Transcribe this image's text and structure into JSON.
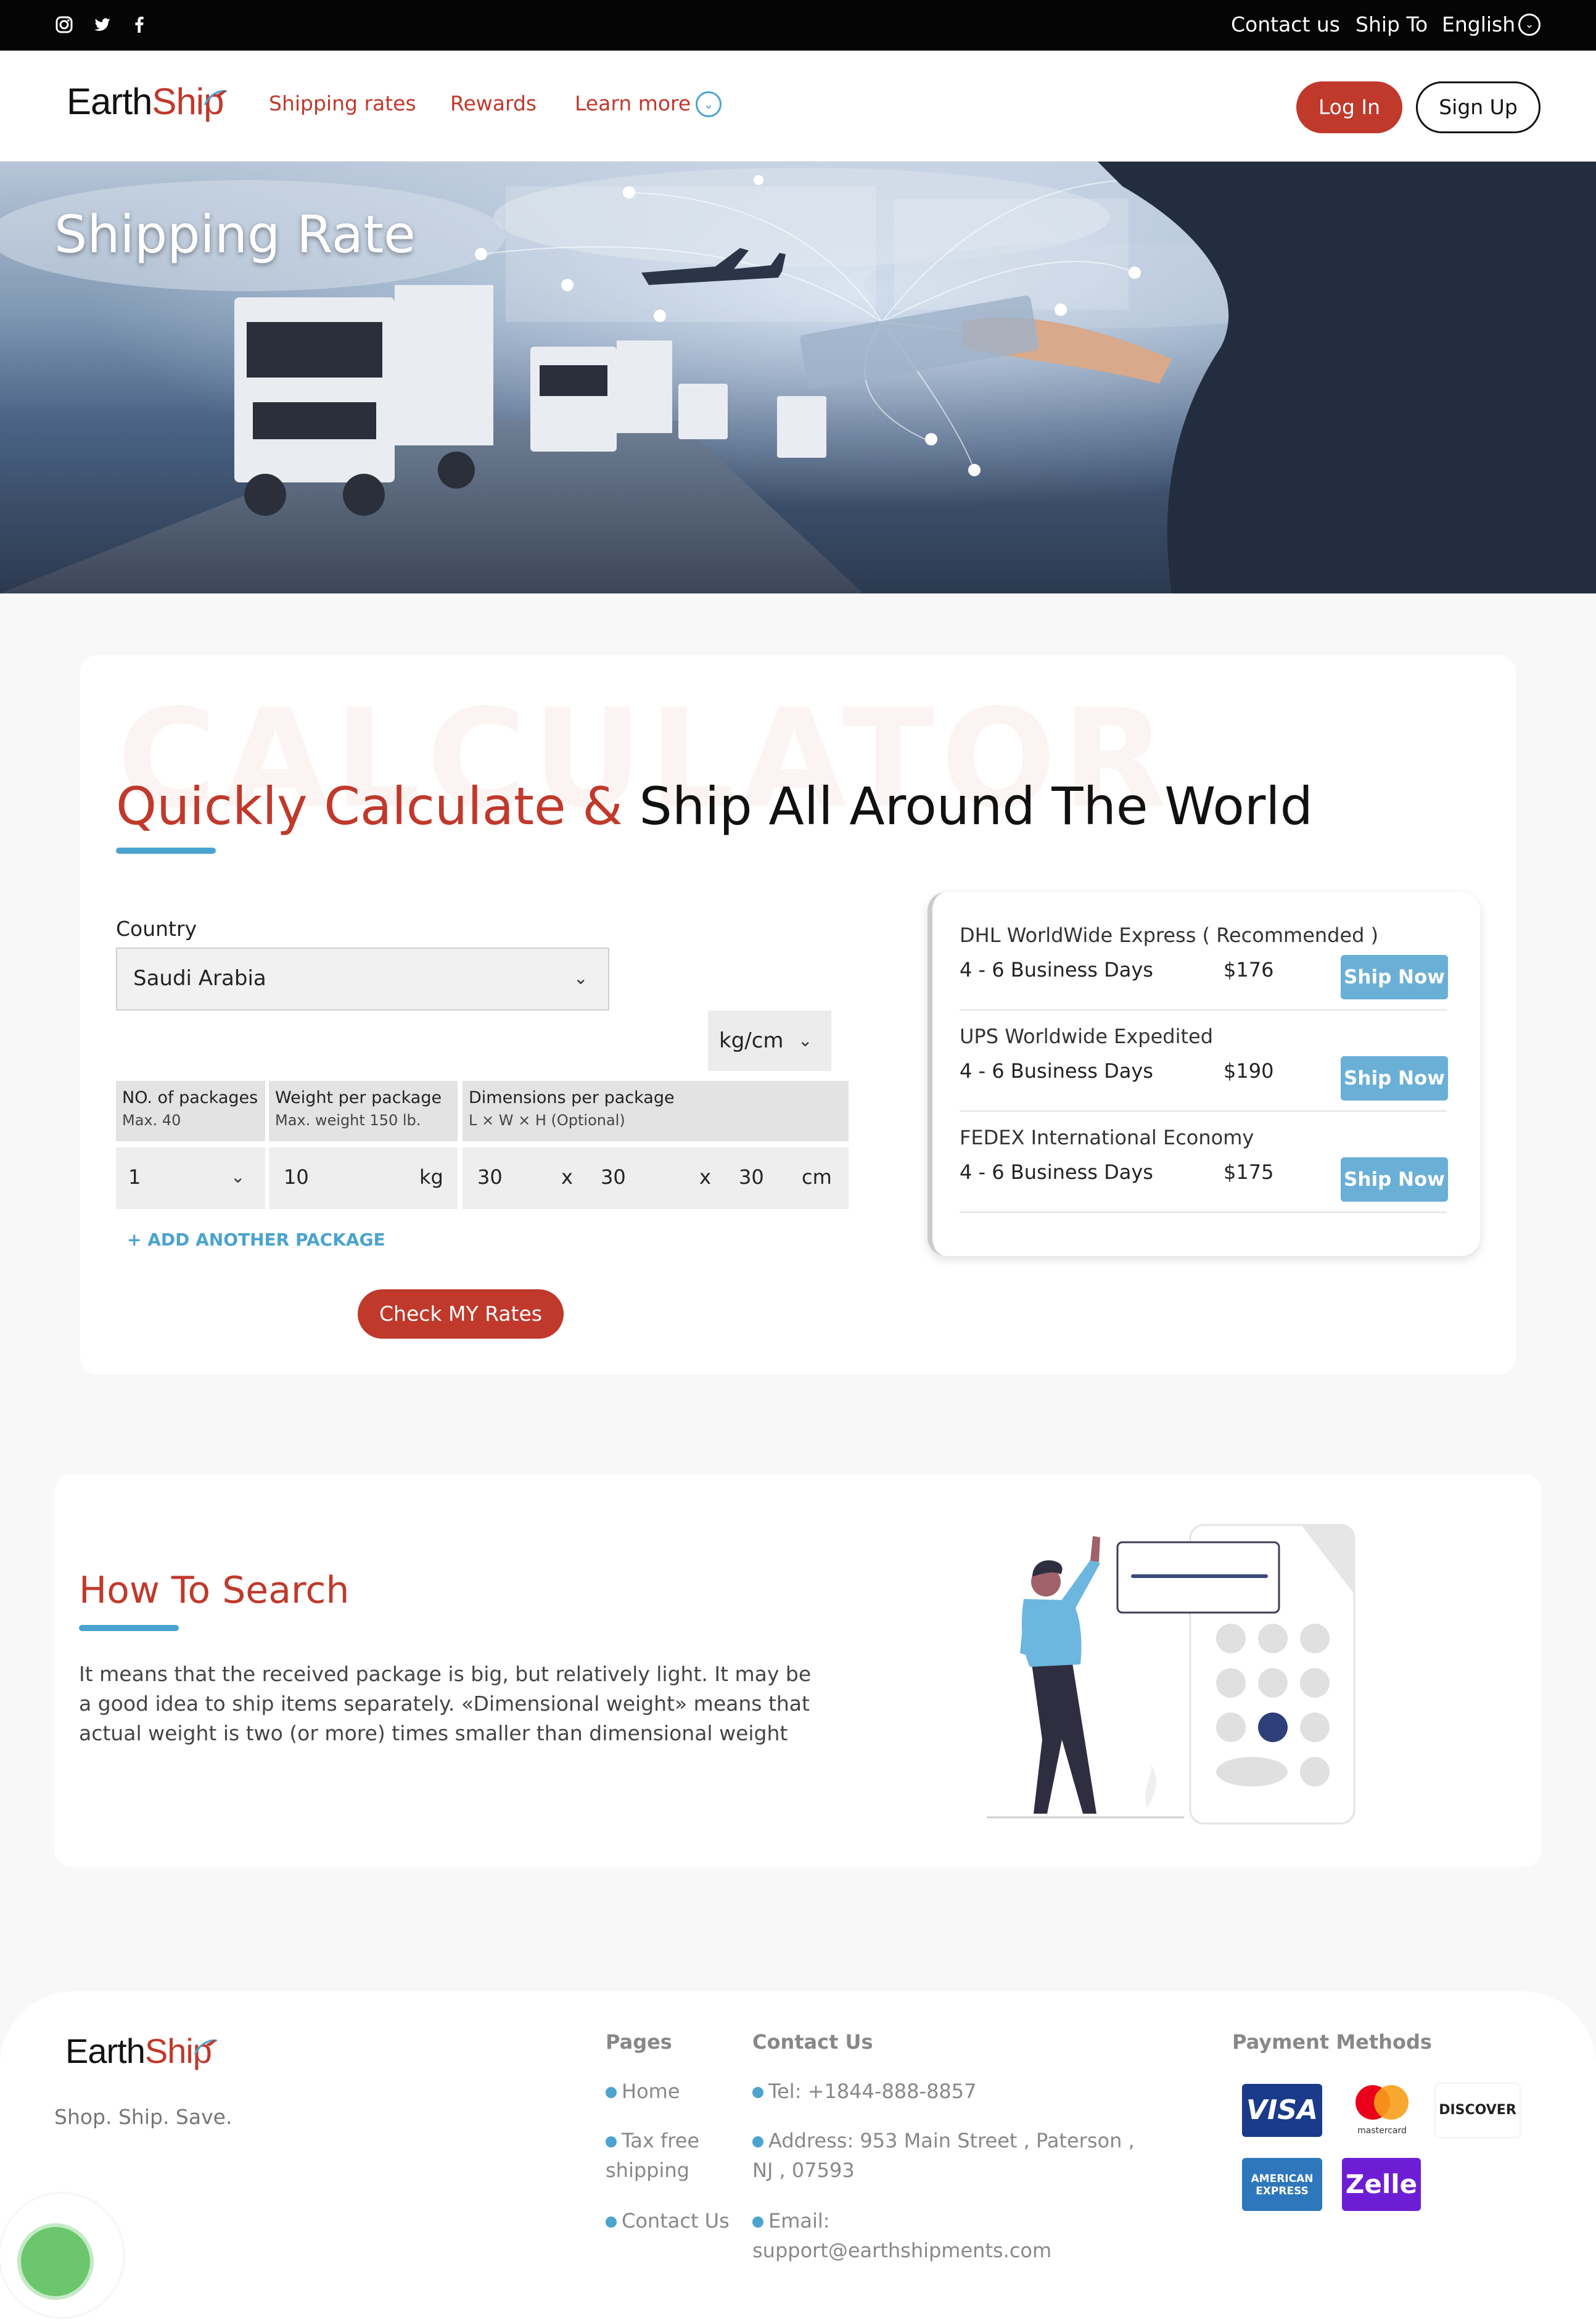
{
  "topbar": {
    "social": [
      "instagram-icon",
      "twitter-icon",
      "facebook-icon"
    ],
    "contact": "Contact us",
    "ship_to": "Ship To",
    "language": "English"
  },
  "header": {
    "logo": {
      "part1": "Earth",
      "part2": "Ship"
    },
    "nav": [
      "Shipping rates",
      "Rewards",
      "Learn more"
    ],
    "login": "Log In",
    "signup": "Sign Up"
  },
  "hero": {
    "title": "Shipping Rate"
  },
  "calculator": {
    "watermark": "CALCULATOR",
    "title_red": "Quickly Calculate &",
    "title_black": "Ship All Around The World",
    "country_label": "Country",
    "country_value": "Saudi Arabia",
    "unit_value": "kg/cm",
    "columns": [
      {
        "title": "NO. of packages",
        "sub": "Max. 40"
      },
      {
        "title": "Weight per package",
        "sub": "Max. weight 150 lb."
      },
      {
        "title": "Dimensions per package",
        "sub": "L × W × H (Optional)"
      }
    ],
    "row": {
      "packages": "1",
      "weight": "10",
      "weight_unit": "kg",
      "length": "30",
      "width": "30",
      "height": "30",
      "sep": "x",
      "dim_unit": "cm"
    },
    "add_package": "+ ADD ANOTHER PACKAGE",
    "check_button": "Check MY Rates"
  },
  "rates": [
    {
      "name": "DHL WorldWide Express ( Recommended )",
      "days": "4 - 6 Business Days",
      "price": "$176",
      "button": "Ship Now"
    },
    {
      "name": "UPS Worldwide Expedited",
      "days": "4 - 6 Business Days",
      "price": "$190",
      "button": "Ship Now"
    },
    {
      "name": "FEDEX International Economy",
      "days": "4 - 6 Business Days",
      "price": "$175",
      "button": "Ship Now"
    }
  ],
  "how": {
    "title": "How To Search",
    "text": "It means that the received package is big, but relatively light. It may be a good idea to ship items separately. «Dimensional weight» means that actual weight is two (or more) times smaller than dimensional weight"
  },
  "footer": {
    "logo": {
      "part1": "Earth",
      "part2": "Ship"
    },
    "tagline": "Shop. Ship. Save.",
    "pages_title": "Pages",
    "pages": [
      "Home",
      "Tax free shipping",
      "Contact Us"
    ],
    "contact_title": "Contact Us",
    "tel": "Tel: +1844-888-8857",
    "address": "Address: 953 Main Street , Paterson , NJ , 07593",
    "email_label": "Email:",
    "email": "support@earthshipments.com",
    "payment_title": "Payment Methods",
    "payments": {
      "visa": "VISA",
      "mastercard": "mastercard",
      "discover": "DISCOVER",
      "amex": "AMERICAN EXPRESS",
      "zelle": "Zelle"
    }
  },
  "colors": {
    "brand_red": "#c0392b",
    "accent_blue": "#4ba3cf",
    "ship_now_blue": "#6aafd6"
  }
}
